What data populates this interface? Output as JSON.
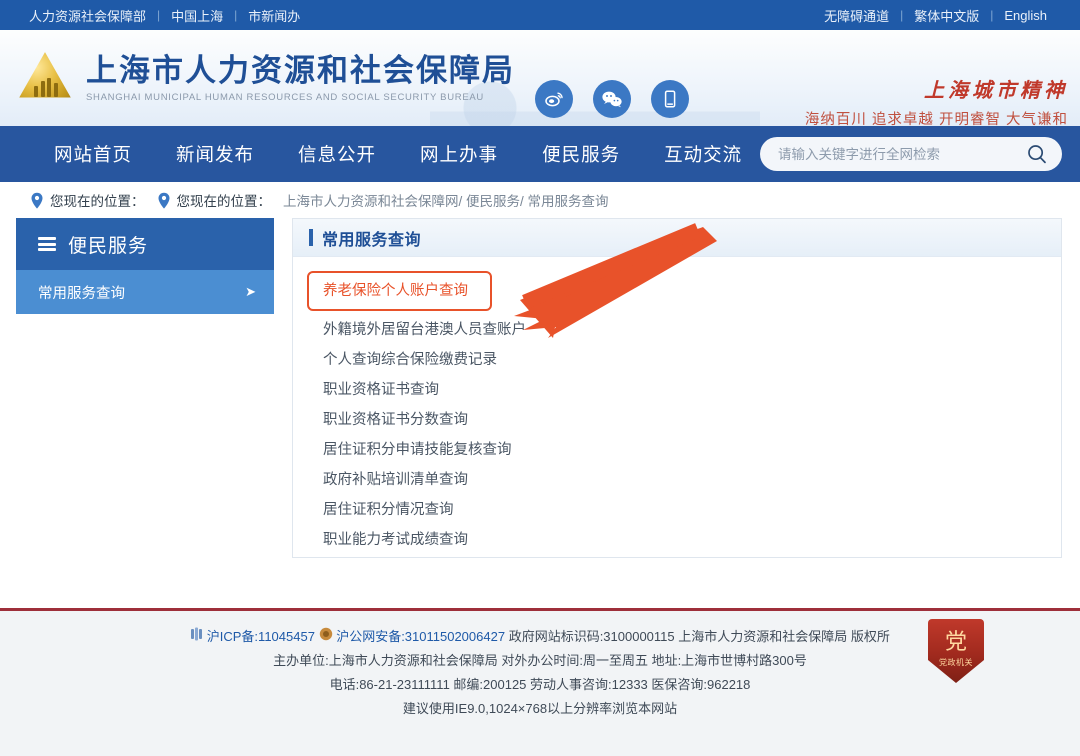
{
  "topbar": {
    "left_links": [
      "人力资源社会保障部",
      "中国上海",
      "市新闻办"
    ],
    "right_links": [
      "无障碍通道",
      "繁体中文版",
      "English"
    ],
    "separator": "|",
    "bg_color": "#1f5aa8"
  },
  "header": {
    "title_cn": "上海市人力资源和社会保障局",
    "title_en": "SHANGHAI MUNICIPAL HUMAN RESOURCES AND SOCIAL SECURITY BUREAU",
    "logo_icon": "golden-triangle-emblem-icon",
    "social": [
      {
        "name": "weibo-icon",
        "glyph": "◎"
      },
      {
        "name": "wechat-icon",
        "glyph": "✉"
      },
      {
        "name": "mobile-icon",
        "glyph": "▯"
      }
    ],
    "slogan_title": "上海城市精神",
    "slogan_text": "海纳百川 追求卓越 开明睿智 大气谦和",
    "slogan_color": "#c0392b"
  },
  "nav": {
    "items": [
      "网站首页",
      "新闻发布",
      "信息公开",
      "网上办事",
      "便民服务",
      "互动交流"
    ],
    "bg_color": "#28569f"
  },
  "search": {
    "placeholder": "请输入关键字进行全网检索",
    "icon": "search-icon"
  },
  "breadcrumb": {
    "pin_icon": "location-pin-icon",
    "label_1": "您现在的位置：",
    "label_2": "您现在的位置：",
    "path": "上海市人力资源和社会保障网/ 便民服务/ 常用服务查询"
  },
  "sidebar": {
    "header": "便民服务",
    "header_icon": "list-icon",
    "items": [
      {
        "label": "常用服务查询",
        "arrow": "➤",
        "active": true
      }
    ]
  },
  "main": {
    "panel_title": "常用服务查询",
    "highlight_color": "#e8522a",
    "items": [
      {
        "label": "养老保险个人账户查询",
        "highlighted": true
      },
      {
        "label": "外籍境外居留台港澳人员查账户",
        "highlighted": false
      },
      {
        "label": "个人查询综合保险缴费记录",
        "highlighted": false
      },
      {
        "label": "职业资格证书查询",
        "highlighted": false
      },
      {
        "label": "职业资格证书分数查询",
        "highlighted": false
      },
      {
        "label": "居住证积分申请技能复核查询",
        "highlighted": false
      },
      {
        "label": "政府补贴培训清单查询",
        "highlighted": false
      },
      {
        "label": "居住证积分情况查询",
        "highlighted": false
      },
      {
        "label": "职业能力考试成绩查询",
        "highlighted": false
      }
    ]
  },
  "annotation": {
    "arrow_color": "#e8522a",
    "points_to": "养老保险个人账户查询"
  },
  "footer": {
    "icp_icon": "icp-icon",
    "icp_label": "沪ICP备:11045457",
    "police_icon": "police-badge-icon",
    "police_label": "沪公网安备:31011502006427",
    "line1_rest": "政府网站标识码:3100000115 上海市人力资源和社会保障局 版权所",
    "line2": "主办单位:上海市人力资源和社会保障局 对外办公时间:周一至周五 地址:上海市世博村路300号",
    "line3": "电话:86-21-23111111 邮编:200125 劳动人事咨询:12333 医保咨询:962218",
    "line4": "建议使用IE9.0,1024×768以上分辨率浏览本网站",
    "seal_glyph": "党",
    "seal_text": "党政机关",
    "border_color": "#9e2f3a"
  }
}
